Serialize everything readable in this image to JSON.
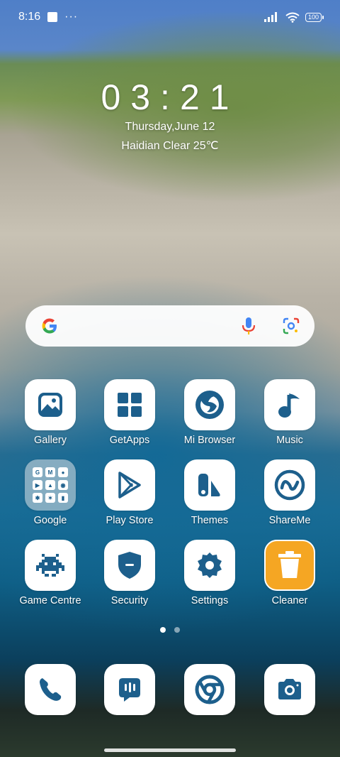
{
  "status_bar": {
    "time": "8:16",
    "dots": "···",
    "battery": "100"
  },
  "lockscreen_widget": {
    "clock": "03:21",
    "date": "Thursday,June 12",
    "weather": "Haidian Clear 25℃"
  },
  "search": {
    "icons": [
      "google-icon",
      "mic-icon",
      "lens-icon"
    ]
  },
  "apps": {
    "row1": [
      {
        "label": "Gallery",
        "icon": "gallery-icon"
      },
      {
        "label": "GetApps",
        "icon": "getapps-icon"
      },
      {
        "label": "Mi Browser",
        "icon": "browser-icon"
      },
      {
        "label": "Music",
        "icon": "music-icon"
      }
    ],
    "row2": [
      {
        "label": "Google",
        "icon": "folder-icon"
      },
      {
        "label": "Play Store",
        "icon": "play-store-icon"
      },
      {
        "label": "Themes",
        "icon": "themes-icon"
      },
      {
        "label": "ShareMe",
        "icon": "shareme-icon"
      }
    ],
    "row3": [
      {
        "label": "Game Centre",
        "icon": "game-icon"
      },
      {
        "label": "Security",
        "icon": "security-icon"
      },
      {
        "label": "Settings",
        "icon": "settings-icon"
      },
      {
        "label": "Cleaner",
        "icon": "cleaner-icon"
      }
    ]
  },
  "dock": [
    "phone-icon",
    "messages-icon",
    "chrome-icon",
    "camera-icon"
  ],
  "pager": {
    "pages": 2,
    "active": 1
  },
  "colors": {
    "icon_blue": "#1d5f8c",
    "cleaner": "#f5a623"
  }
}
